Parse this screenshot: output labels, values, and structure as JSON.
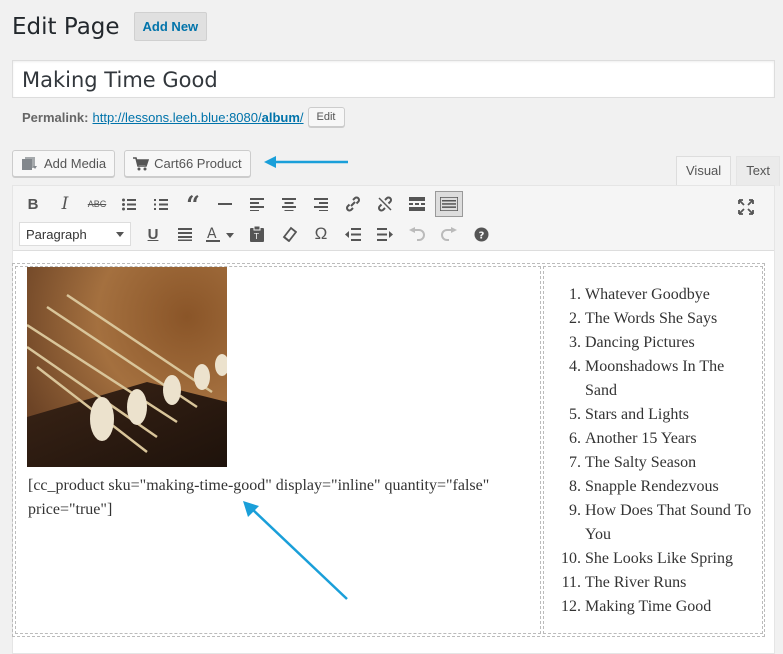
{
  "header": {
    "title": "Edit Page",
    "add_new": "Add New"
  },
  "title_field": {
    "value": "Making Time Good"
  },
  "permalink": {
    "label": "Permalink:",
    "url_prefix": "http://lessons.leeh.blue:8080/",
    "url_slug": "album",
    "url_suffix": "/",
    "edit_label": "Edit"
  },
  "media_buttons": {
    "add_media": "Add Media",
    "cart66": "Cart66 Product"
  },
  "editor_tabs": {
    "visual": "Visual",
    "text": "Text"
  },
  "toolbar": {
    "format_value": "Paragraph",
    "row1_icons": [
      "bold-icon",
      "italic-icon",
      "strikethrough-icon",
      "bullet-list-icon",
      "numbered-list-icon",
      "blockquote-icon",
      "horizontal-rule-icon",
      "align-left-icon",
      "align-center-icon",
      "align-right-icon",
      "link-icon",
      "unlink-icon",
      "read-more-icon",
      "toolbar-toggle-icon"
    ],
    "row2_icons": [
      "underline-icon",
      "justify-icon",
      "text-color-icon",
      "paste-text-icon",
      "clear-formatting-icon",
      "special-character-icon",
      "outdent-icon",
      "indent-icon",
      "undo-icon",
      "redo-icon",
      "help-icon"
    ]
  },
  "content": {
    "shortcode": "[cc_product sku=\"making-time-good\" display=\"inline\" quantity=\"false\" price=\"true\"]",
    "tracks": [
      {
        "num": "1.",
        "title": "Whatever Goodbye"
      },
      {
        "num": "2.",
        "title": "The Words She Says"
      },
      {
        "num": "3.",
        "title": "Dancing Pictures"
      },
      {
        "num": "4.",
        "title": "Moonshadows In The Sand"
      },
      {
        "num": "5.",
        "title": "Stars and Lights"
      },
      {
        "num": "6.",
        "title": "Another 15 Years"
      },
      {
        "num": "7.",
        "title": "The Salty Season"
      },
      {
        "num": "8.",
        "title": "Snapple Rendezvous"
      },
      {
        "num": "9.",
        "title": "How Does That Sound To You"
      },
      {
        "num": "10.",
        "title": "She Looks Like Spring"
      },
      {
        "num": "11.",
        "title": "The River Runs"
      },
      {
        "num": "12.",
        "title": "Making Time Good"
      }
    ]
  },
  "colors": {
    "accent": "#0073aa",
    "annotation_arrow": "#1a9fd9"
  }
}
